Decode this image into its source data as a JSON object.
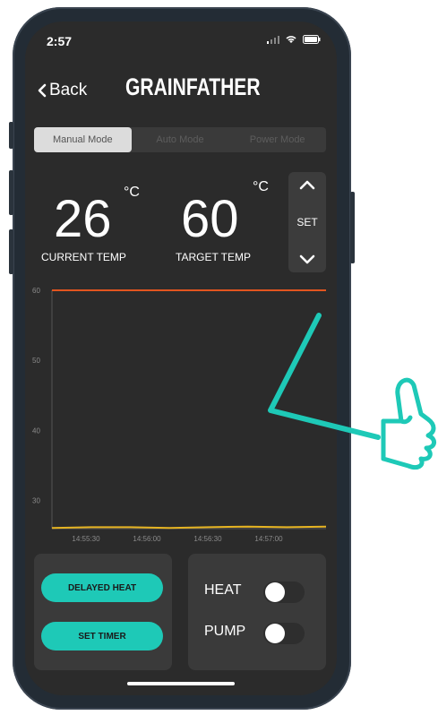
{
  "status": {
    "time": "2:57"
  },
  "nav": {
    "back_label": "Back",
    "brand": "GRAINFATHER"
  },
  "modes": [
    {
      "label": "Manual Mode",
      "active": true
    },
    {
      "label": "Auto Mode",
      "active": false
    },
    {
      "label": "Power Mode",
      "active": false
    }
  ],
  "temps": {
    "current_value": "26",
    "target_value": "60",
    "unit": "°C",
    "current_label": "CURRENT TEMP",
    "target_label": "TARGET TEMP"
  },
  "set_control": {
    "label": "SET"
  },
  "chart_data": {
    "type": "line",
    "y_ticks": [
      30,
      40,
      50,
      60
    ],
    "x_ticks": [
      "14:55:30",
      "14:56:00",
      "14:56:30",
      "14:57:00"
    ],
    "ylim": [
      26,
      60
    ],
    "series": [
      {
        "color": "#e2551f",
        "values": [
          60,
          60,
          60,
          60,
          60,
          60,
          60,
          60
        ]
      },
      {
        "color": "#e6b422",
        "values": [
          26.1,
          26.2,
          26.2,
          26.1,
          26.2,
          26.3,
          26.2,
          26.3
        ]
      }
    ],
    "grid": false
  },
  "controls": {
    "delayed_heat": "DELAYED HEAT",
    "set_timer": "SET TIMER"
  },
  "toggles": [
    {
      "label": "HEAT",
      "on": false
    },
    {
      "label": "PUMP",
      "on": false
    }
  ],
  "colors": {
    "accent": "#1ec9b7",
    "target_line": "#e2551f",
    "current_line": "#e6b422",
    "background": "#2b2b2b"
  }
}
